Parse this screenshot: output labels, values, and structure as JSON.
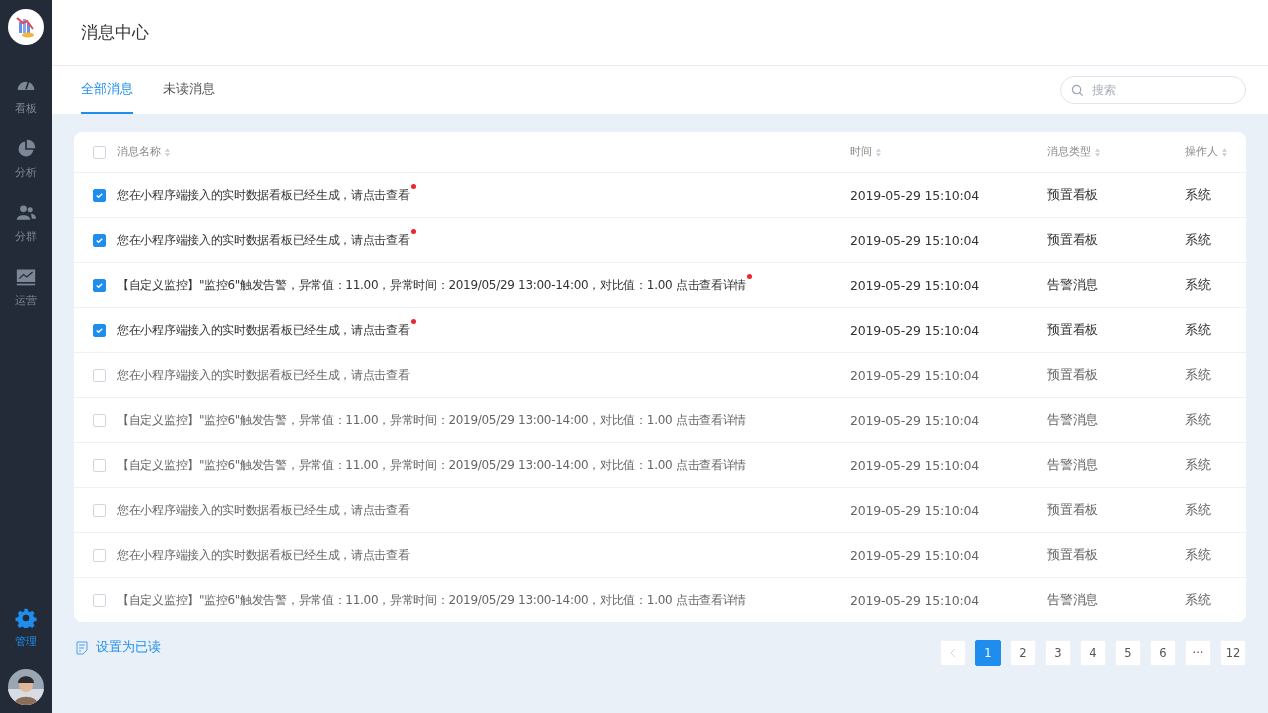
{
  "sidebar": {
    "items": [
      {
        "label": "看板",
        "selected": false
      },
      {
        "label": "分析",
        "selected": false
      },
      {
        "label": "分群",
        "selected": false
      },
      {
        "label": "运营",
        "selected": false
      }
    ],
    "bottom_items": [
      {
        "label": "管理",
        "selected": true
      }
    ]
  },
  "header": {
    "title": "消息中心"
  },
  "tabs": [
    {
      "label": "全部消息",
      "selected": true
    },
    {
      "label": "未读消息",
      "selected": false
    }
  ],
  "search": {
    "placeholder": "搜索"
  },
  "table": {
    "select_all": {
      "checked": false
    },
    "columns": [
      "消息名称",
      "时间",
      "消息类型",
      "操作人"
    ],
    "rows": [
      {
        "checked": true,
        "unread": true,
        "name": "您在小程序端接入的实时数据看板已经生成，请点击查看",
        "time": "2019-05-29 15:10:04",
        "type": "预置看板",
        "operator": "系统"
      },
      {
        "checked": true,
        "unread": true,
        "name": "您在小程序端接入的实时数据看板已经生成，请点击查看",
        "time": "2019-05-29 15:10:04",
        "type": "预置看板",
        "operator": "系统"
      },
      {
        "checked": true,
        "unread": true,
        "name": "【自定义监控】\"监控6\"触发告警，异常值：11.00，异常时间：2019/05/29 13:00-14:00，对比值：1.00 点击查看详情",
        "time": "2019-05-29 15:10:04",
        "type": "告警消息",
        "operator": "系统"
      },
      {
        "checked": true,
        "unread": true,
        "name": "您在小程序端接入的实时数据看板已经生成，请点击查看",
        "time": "2019-05-29 15:10:04",
        "type": "预置看板",
        "operator": "系统"
      },
      {
        "checked": false,
        "unread": false,
        "name": "您在小程序端接入的实时数据看板已经生成，请点击查看",
        "time": "2019-05-29 15:10:04",
        "type": "预置看板",
        "operator": "系统"
      },
      {
        "checked": false,
        "unread": false,
        "name": "【自定义监控】\"监控6\"触发告警，异常值：11.00，异常时间：2019/05/29 13:00-14:00，对比值：1.00 点击查看详情",
        "time": "2019-05-29 15:10:04",
        "type": "告警消息",
        "operator": "系统"
      },
      {
        "checked": false,
        "unread": false,
        "name": "【自定义监控】\"监控6\"触发告警，异常值：11.00，异常时间：2019/05/29 13:00-14:00，对比值：1.00 点击查看详情",
        "time": "2019-05-29 15:10:04",
        "type": "告警消息",
        "operator": "系统"
      },
      {
        "checked": false,
        "unread": false,
        "name": "您在小程序端接入的实时数据看板已经生成，请点击查看",
        "time": "2019-05-29 15:10:04",
        "type": "预置看板",
        "operator": "系统"
      },
      {
        "checked": false,
        "unread": false,
        "name": "您在小程序端接入的实时数据看板已经生成，请点击查看",
        "time": "2019-05-29 15:10:04",
        "type": "预置看板",
        "operator": "系统"
      },
      {
        "checked": false,
        "unread": false,
        "name": "【自定义监控】\"监控6\"触发告警，异常值：11.00，异常时间：2019/05/29 13:00-14:00，对比值：1.00 点击查看详情",
        "time": "2019-05-29 15:10:04",
        "type": "告警消息",
        "operator": "系统"
      }
    ]
  },
  "footer": {
    "mark_read": "设置为已读"
  },
  "pagination": {
    "prev_disabled": true,
    "pages": [
      {
        "label": "1",
        "selected": true
      },
      {
        "label": "2",
        "selected": false
      },
      {
        "label": "3",
        "selected": false
      },
      {
        "label": "4",
        "selected": false
      },
      {
        "label": "5",
        "selected": false
      },
      {
        "label": "6",
        "selected": false
      },
      {
        "label": "···",
        "selected": false
      },
      {
        "label": "12",
        "selected": false
      }
    ]
  }
}
